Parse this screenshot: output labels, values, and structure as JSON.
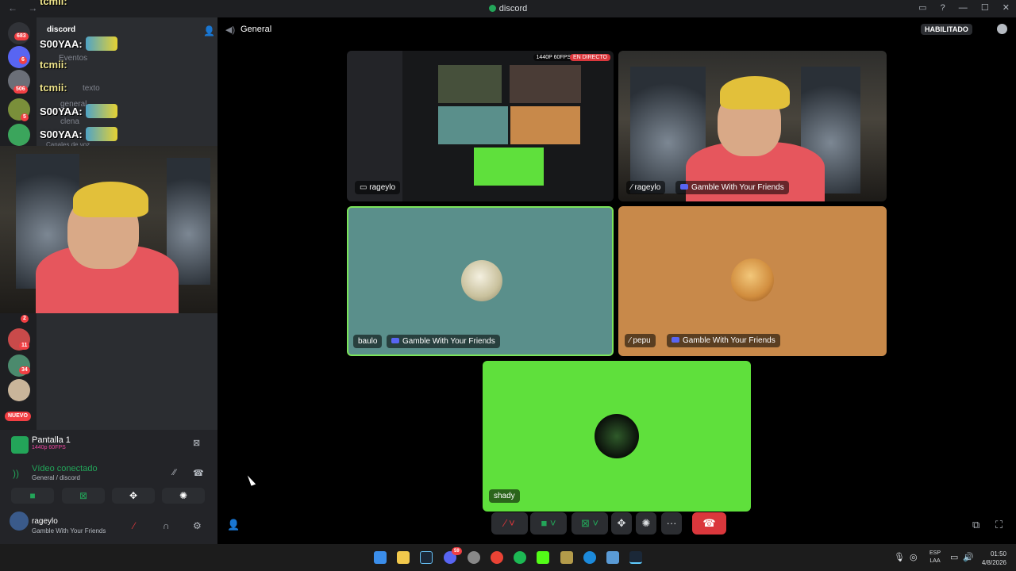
{
  "window": {
    "title": "discord"
  },
  "rail": {
    "badges": [
      "683",
      "6",
      "506",
      "5",
      "2",
      "11",
      "34"
    ],
    "new_label": "NUEVO"
  },
  "channels": {
    "server_name": "discord",
    "items": [
      "Eventos",
      "texto",
      "general",
      "clena",
      "Canales de voz"
    ]
  },
  "chat_overlay": [
    {
      "user": "tcmii:",
      "text": ""
    },
    {
      "user": "S00YAA:",
      "text": ""
    },
    {
      "user": "tcmii:",
      "text": ""
    },
    {
      "user": "tcmii:",
      "text": ""
    },
    {
      "user": "S00YAA:",
      "text": ""
    },
    {
      "user": "S00YAA:",
      "text": ""
    }
  ],
  "stream_panel": {
    "name": "Pantalla 1",
    "quality": "1440p 60FPS"
  },
  "voice_panel": {
    "status": "Vídeo conectado",
    "location": "General / discord"
  },
  "user": {
    "name": "rageylo",
    "activity": "Gamble With Your Friends"
  },
  "main": {
    "channel": "General",
    "enabled_label": "HABILITADO"
  },
  "tiles": {
    "stream": {
      "quality": "1440P 60FPS",
      "live": "EN DIRECTO",
      "user": "rageylo"
    },
    "cam": {
      "user": "rageylo",
      "activity": "Gamble With Your Friends"
    },
    "baulo": {
      "user": "baulo",
      "activity": "Gamble With Your Friends",
      "bg": "#5a8f8b"
    },
    "pepu": {
      "user": "pepu",
      "activity": "Gamble With Your Friends",
      "bg": "#c8894a"
    },
    "shady": {
      "user": "shady",
      "bg": "#5fe03c"
    }
  },
  "call_bar": {
    "more": "···"
  },
  "taskbar": {
    "lang": "ESP",
    "layout": "LAA",
    "time": "01:50",
    "date": "4/8/2026",
    "discord_badge": "59"
  },
  "colors": {
    "danger": "#da373c",
    "green": "#23a559",
    "blurple": "#5865f2"
  }
}
